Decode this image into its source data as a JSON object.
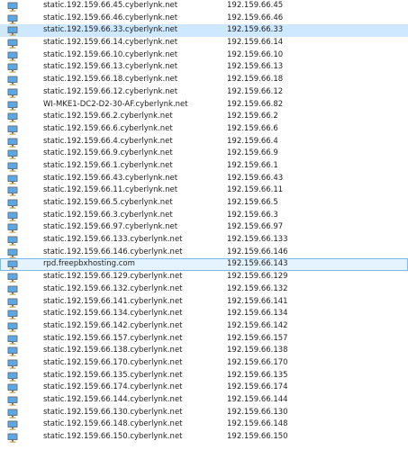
{
  "list": {
    "rows": [
      {
        "name": "static.192.159.66.45.cyberlynk.net",
        "ip": "192.159.66.45"
      },
      {
        "name": "static.192.159.66.46.cyberlynk.net",
        "ip": "192.159.66.46"
      },
      {
        "name": "static.192.159.66.33.cyberlynk.net",
        "ip": "192.159.66.33",
        "selected": true
      },
      {
        "name": "static.192.159.66.14.cyberlynk.net",
        "ip": "192.159.66.14"
      },
      {
        "name": "static.192.159.66.10.cyberlynk.net",
        "ip": "192.159.66.10"
      },
      {
        "name": "static.192.159.66.13.cyberlynk.net",
        "ip": "192.159.66.13"
      },
      {
        "name": "static.192.159.66.18.cyberlynk.net",
        "ip": "192.159.66.18"
      },
      {
        "name": "static.192.159.66.12.cyberlynk.net",
        "ip": "192.159.66.12"
      },
      {
        "name": "WI-MKE1-DC2-D2-30-AF.cyberlynk.net",
        "ip": "192.159.66.82"
      },
      {
        "name": "static.192.159.66.2.cyberlynk.net",
        "ip": "192.159.66.2"
      },
      {
        "name": "static.192.159.66.6.cyberlynk.net",
        "ip": "192.159.66.6"
      },
      {
        "name": "static.192.159.66.4.cyberlynk.net",
        "ip": "192.159.66.4"
      },
      {
        "name": "static.192.159.66.9.cyberlynk.net",
        "ip": "192.159.66.9"
      },
      {
        "name": "static.192.159.66.1.cyberlynk.net",
        "ip": "192.159.66.1"
      },
      {
        "name": "static.192.159.66.43.cyberlynk.net",
        "ip": "192.159.66.43"
      },
      {
        "name": "static.192.159.66.11.cyberlynk.net",
        "ip": "192.159.66.11"
      },
      {
        "name": "static.192.159.66.5.cyberlynk.net",
        "ip": "192.159.66.5"
      },
      {
        "name": "static.192.159.66.3.cyberlynk.net",
        "ip": "192.159.66.3"
      },
      {
        "name": "static.192.159.66.97.cyberlynk.net",
        "ip": "192.159.66.97"
      },
      {
        "name": "static.192.159.66.133.cyberlynk.net",
        "ip": "192.159.66.133"
      },
      {
        "name": "static.192.159.66.146.cyberlynk.net",
        "ip": "192.159.66.146"
      },
      {
        "name": "rpd.freepbxhosting.com",
        "ip": "192.159.66.143",
        "focused": true
      },
      {
        "name": "static.192.159.66.129.cyberlynk.net",
        "ip": "192.159.66.129"
      },
      {
        "name": "static.192.159.66.132.cyberlynk.net",
        "ip": "192.159.66.132"
      },
      {
        "name": "static.192.159.66.141.cyberlynk.net",
        "ip": "192.159.66.141"
      },
      {
        "name": "static.192.159.66.134.cyberlynk.net",
        "ip": "192.159.66.134"
      },
      {
        "name": "static.192.159.66.142.cyberlynk.net",
        "ip": "192.159.66.142"
      },
      {
        "name": "static.192.159.66.157.cyberlynk.net",
        "ip": "192.159.66.157"
      },
      {
        "name": "static.192.159.66.138.cyberlynk.net",
        "ip": "192.159.66.138"
      },
      {
        "name": "static.192.159.66.170.cyberlynk.net",
        "ip": "192.159.66.170"
      },
      {
        "name": "static.192.159.66.135.cyberlynk.net",
        "ip": "192.159.66.135"
      },
      {
        "name": "static.192.159.66.174.cyberlynk.net",
        "ip": "192.159.66.174"
      },
      {
        "name": "static.192.159.66.144.cyberlynk.net",
        "ip": "192.159.66.144"
      },
      {
        "name": "static.192.159.66.130.cyberlynk.net",
        "ip": "192.159.66.130"
      },
      {
        "name": "static.192.159.66.148.cyberlynk.net",
        "ip": "192.159.66.148"
      },
      {
        "name": "static.192.159.66.150.cyberlynk.net",
        "ip": "192.159.66.150"
      }
    ]
  },
  "icon": {
    "name": "computer-icon",
    "screen_color": "#5aa9e6",
    "frame_color": "#6a7380",
    "base_color": "#c9a94a"
  }
}
